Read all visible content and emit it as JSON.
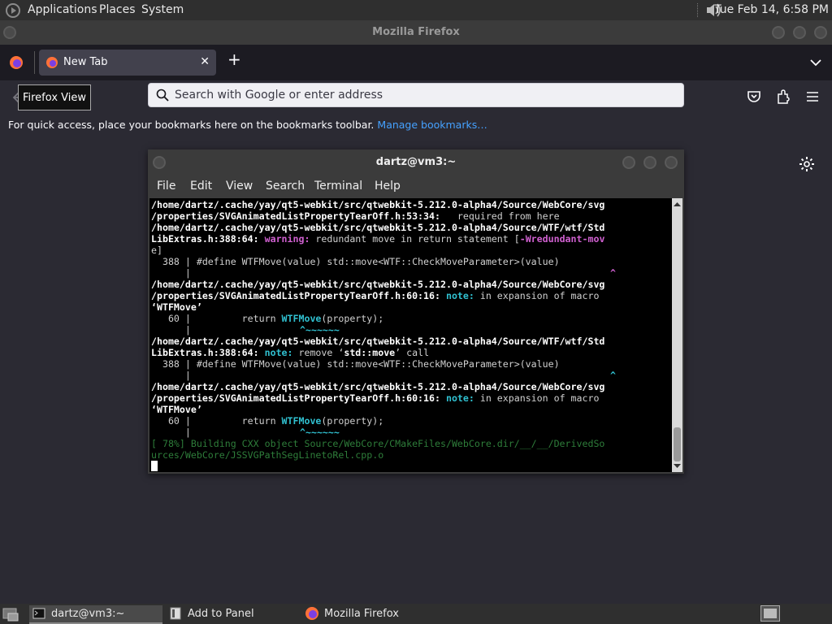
{
  "top_panel": {
    "menus": [
      "Applications",
      "Places",
      "System"
    ],
    "clock": "Tue Feb 14,  6:58 PM"
  },
  "firefox": {
    "window_title": "Mozilla Firefox",
    "tooltip": "Firefox View",
    "tab_label": "New Tab",
    "tab_close": "✕",
    "new_tab": "+",
    "url_placeholder": "Search with Google or enter address",
    "bookmarks_text": "For quick access, place your bookmarks here on the bookmarks toolbar.",
    "manage_bookmarks": "Manage bookmarks…"
  },
  "terminal": {
    "title": "dartz@vm3:~",
    "menus": [
      "File",
      "Edit",
      "View",
      "Search",
      "Terminal",
      "Help"
    ],
    "lines": [
      "/home/dartz/.cache/yay/qt5-webkit/src/qtwebkit-5.212.0-alpha4/Source/WebCore/svg",
      "/properties/SVGAnimatedListPropertyTearOff.h:53:34:",
      "   required from here",
      "/home/dartz/.cache/yay/qt5-webkit/src/qtwebkit-5.212.0-alpha4/Source/WTF/wtf/Std",
      "LibExtras.h:388:64:",
      " warning:",
      " redundant move in return statement [",
      "-Wredundant-mov",
      "e]",
      "  388 | #define WTFMove(value) std::move<WTF::CheckMoveParameter>(value)",
      "      |",
      "^",
      "/home/dartz/.cache/yay/qt5-webkit/src/qtwebkit-5.212.0-alpha4/Source/WebCore/svg",
      "/properties/SVGAnimatedListPropertyTearOff.h:60:16:",
      " note:",
      " in expansion of macro",
      "‘WTFMove’",
      "   60 |         return ",
      "WTFMove",
      "(property);",
      "      |",
      "^~~~~~~",
      "LibExtras.h:388:64:",
      " remove ‘",
      "std::move",
      "’ call",
      "   60 |         return ",
      "[ 78%] Building CXX object Source/WebCore/CMakeFiles/WebCore.dir/__/__/DerivedSo",
      "urces/WebCore/JSSVGPathSegLinetoRel.cpp.o"
    ]
  },
  "bottom_panel": {
    "tasks": [
      "dartz@vm3:~",
      "Add to Panel",
      "Mozilla Firefox"
    ]
  },
  "colors": {
    "accent_link": "#45a1ff",
    "terminal_note": "#30c0d0",
    "terminal_warning": "#d060d0"
  }
}
